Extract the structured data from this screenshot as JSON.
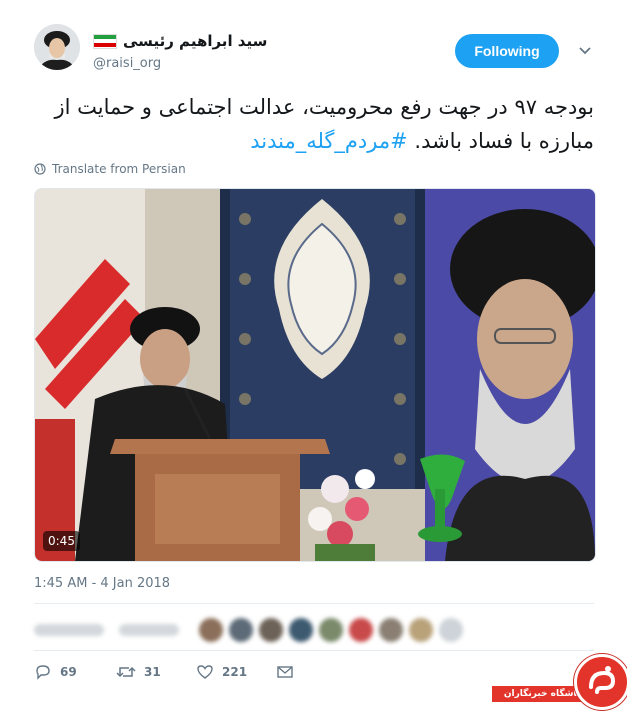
{
  "tweet": {
    "author": {
      "display_name": "سید ابراهیم رئیسی",
      "handle": "@raisi_org"
    },
    "follow_button_label": "Following",
    "text": "بودجه ۹۷ در جهت رفع محرومیت، عدالت اجتماعی و حمایت از مبارزه با فساد باشد.",
    "hashtag": "#مردم_گله_مندند",
    "translate_label": "Translate from Persian",
    "video": {
      "duration": "0:45"
    },
    "timestamp": "1:45 AM - 4 Jan 2018",
    "actions": {
      "reply_count": "69",
      "retweet_count": "31",
      "like_count": "221"
    }
  },
  "watermark": {
    "text": "باشگاه خبرنگاران"
  },
  "colors": {
    "accent": "#1da1f2",
    "muted": "#657786",
    "watermark_red": "#e2342a"
  }
}
